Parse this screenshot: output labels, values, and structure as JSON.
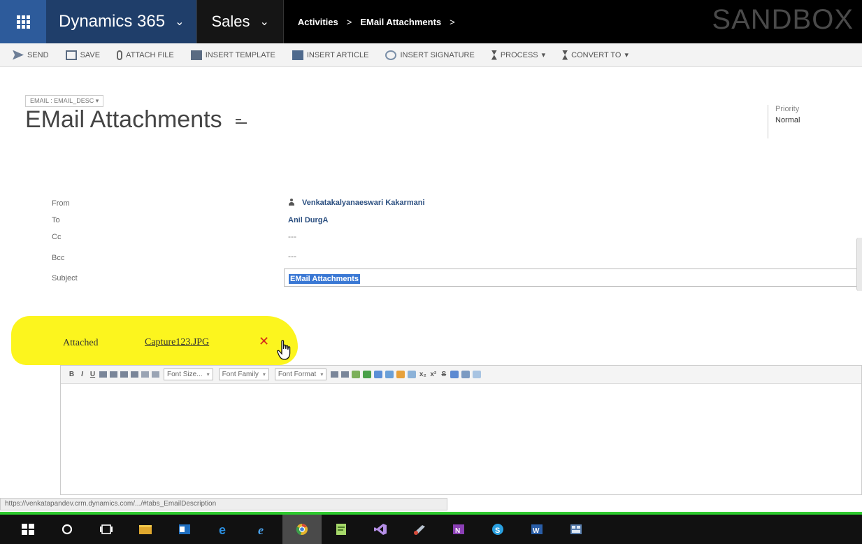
{
  "nav": {
    "app_name": "Dynamics 365",
    "module": "Sales",
    "breadcrumbs": [
      "Activities",
      "EMail Attachments"
    ],
    "environment": "SANDBOX"
  },
  "commands": {
    "send": "SEND",
    "save": "SAVE",
    "attach_file": "ATTACH FILE",
    "insert_template": "INSERT TEMPLATE",
    "insert_article": "INSERT ARTICLE",
    "insert_signature": "INSERT SIGNATURE",
    "process": "PROCESS",
    "convert_to": "CONVERT TO"
  },
  "header": {
    "form_selector": "EMAIL : EMAIL_DESC",
    "title": "EMail Attachments",
    "priority_label": "Priority",
    "priority_value": "Normal"
  },
  "fields": {
    "from_label": "From",
    "from_value": "Venkatakalyanaeswari Kakarmani",
    "to_label": "To",
    "to_value": "Anil DurgA",
    "cc_label": "Cc",
    "cc_value": "---",
    "bcc_label": "Bcc",
    "bcc_value": "---",
    "subject_label": "Subject",
    "subject_value": "EMail Attachments"
  },
  "attachment": {
    "label": "Attached",
    "file_name": "Capture123.JPG",
    "remove_glyph": "✕"
  },
  "editor": {
    "font_size_placeholder": "Font Size...",
    "font_family_placeholder": "Font Family",
    "font_format_placeholder": "Font Format"
  },
  "status_url": "https://venkatapandev.crm.dynamics.com/.../#tabs_EmailDescription",
  "colors": {
    "nav_grid": "#2d5b9b",
    "nav_app": "#1f3e6a",
    "highlight": "#fcf51e",
    "remove": "#d42a1a",
    "taskbar_accent": "#2ecb2e"
  }
}
